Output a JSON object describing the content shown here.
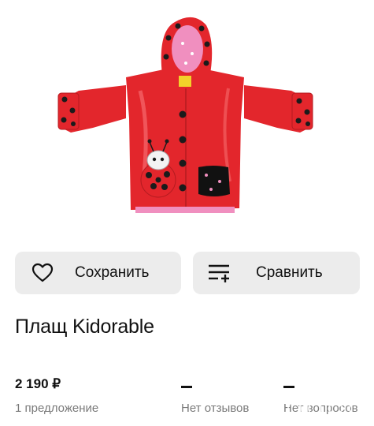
{
  "image": {
    "subject": "child raincoat",
    "colors": {
      "coat": "#e3262c",
      "dots": "#1b1b1b",
      "hood_lining": "#f08fbf"
    }
  },
  "actions": {
    "save": {
      "label": "Сохранить",
      "icon": "heart-icon"
    },
    "compare": {
      "label": "Сравнить",
      "icon": "compare-list-icon"
    }
  },
  "product": {
    "title": "Плащ Kidorable"
  },
  "stats": {
    "price": {
      "value": "2 190 ₽",
      "label": "1 предложение"
    },
    "reviews": {
      "value": "—",
      "label": "Нет отзывов"
    },
    "questions": {
      "value": "—",
      "label": "Нет вопросов"
    }
  },
  "colors": {
    "button_bg": "#ececec",
    "text": "#111111",
    "muted": "#7a7a7a"
  }
}
